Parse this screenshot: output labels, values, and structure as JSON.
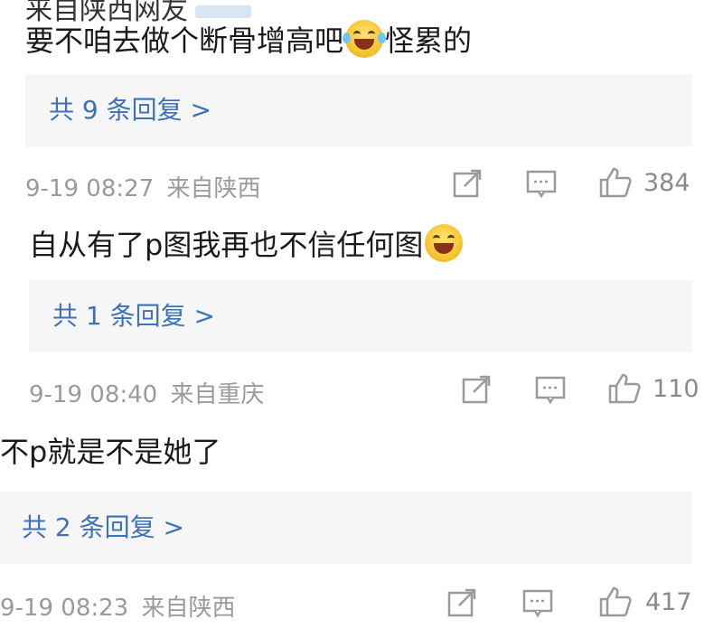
{
  "top_fragment": {
    "text": "来自陕西网友"
  },
  "comments": [
    {
      "text_before": "要不咱去做个断骨增高吧",
      "emoji": "laugh-cry-emoji",
      "text_after": "怪累的",
      "replies_label": "共 9 条回复 >",
      "time": "9-19 08:27",
      "location": "来自陕西",
      "likes": "384"
    },
    {
      "text_before": "自从有了p图我再也不信任何图",
      "emoji": "grin-emoji",
      "text_after": "",
      "replies_label": "共 1 条回复 >",
      "time": "9-19 08:40",
      "location": "来自重庆",
      "likes": "110"
    },
    {
      "text_before": "不p就是不是她了",
      "emoji": "",
      "text_after": "",
      "replies_label": "共 2 条回复 >",
      "time": "9-19 08:23",
      "location": "来自陕西",
      "likes": "417"
    }
  ],
  "colors": {
    "reply_link": "#3b72b8",
    "reply_bg": "#f6f6f6",
    "meta": "#9a9a9a"
  }
}
